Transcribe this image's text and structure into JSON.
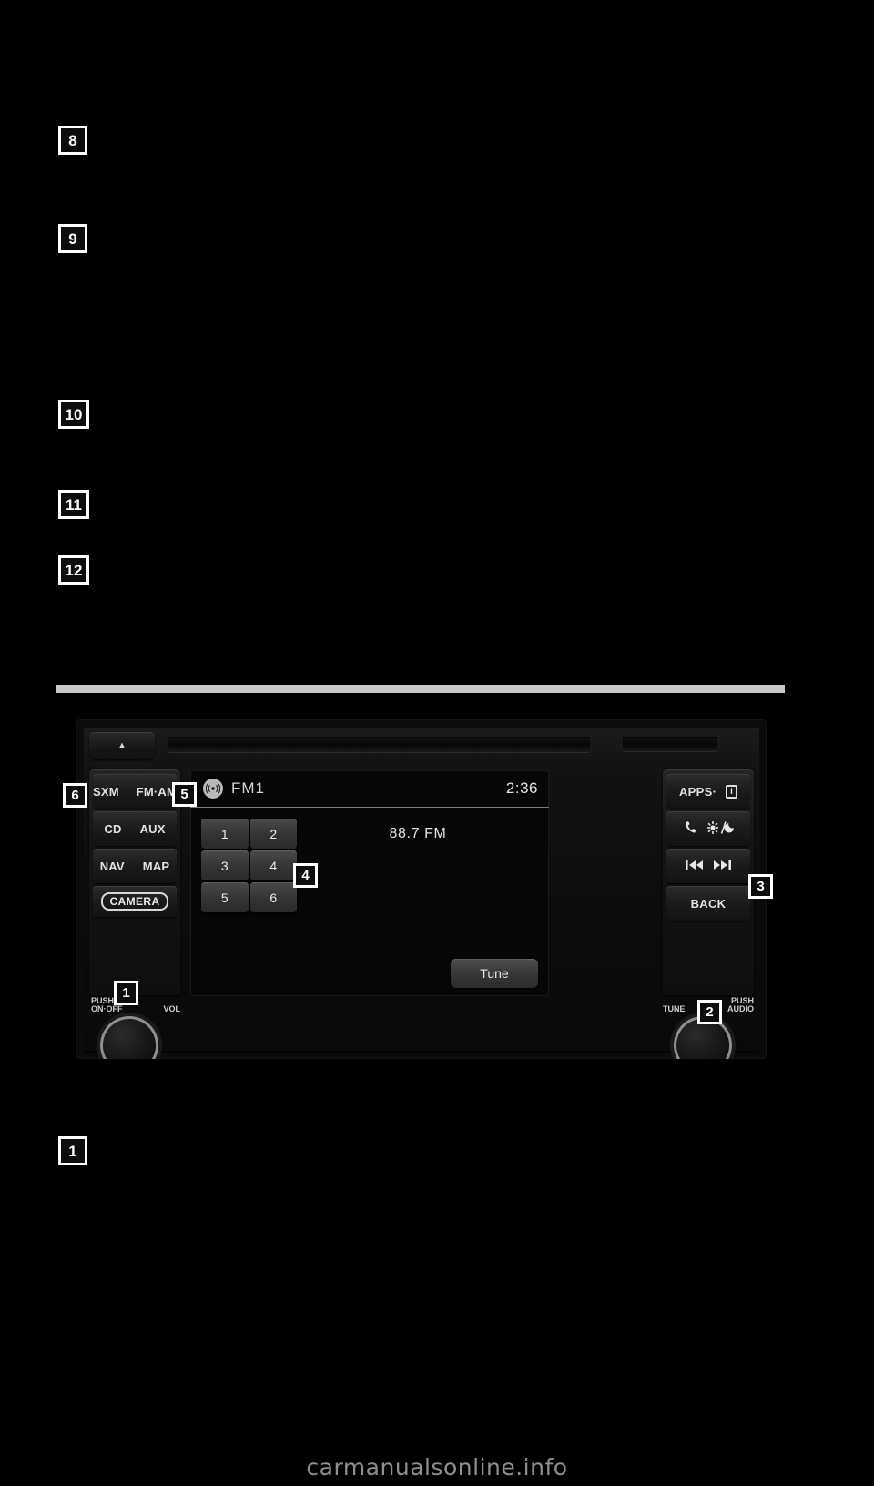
{
  "page": {
    "background_color": "#000000",
    "watermark": "carmanualsonline.info",
    "divider_color": "#c6c8ca"
  },
  "text_callouts": [
    {
      "number": "8"
    },
    {
      "number": "9"
    },
    {
      "number": "10"
    },
    {
      "number": "11"
    },
    {
      "number": "12"
    },
    {
      "number": "1"
    }
  ],
  "figure": {
    "name": "audio-head-unit",
    "callouts": [
      {
        "number": "1"
      },
      {
        "number": "2"
      },
      {
        "number": "3"
      },
      {
        "number": "4"
      },
      {
        "number": "5"
      },
      {
        "number": "6"
      }
    ],
    "top_strip": {
      "eject_icon": "eject-icon",
      "eject_glyph": "▲",
      "cd_slot": "cd-slot",
      "aux_slot": "aux-slot"
    },
    "left_buttons": [
      {
        "left_label": "SXM",
        "right_label": "FM·AM"
      },
      {
        "left_label": "CD",
        "right_label": "AUX"
      },
      {
        "left_label": "NAV",
        "right_label": "MAP"
      }
    ],
    "camera_button": "CAMERA",
    "volume_knob": {
      "label_left_line1": "PUSH",
      "label_left_line2": "ON·OFF",
      "label_right": "VOL"
    },
    "tune_knob": {
      "label_left": "TUNE",
      "label_right_line1": "PUSH",
      "label_right_line2": "AUDIO"
    },
    "right_buttons": [
      {
        "label": "APPS·",
        "icon": "info-icon",
        "icon_glyph": "i"
      },
      {
        "label": "",
        "icon_left": "phone-icon",
        "icon_left_glyph": "✆",
        "icon_right": "brightness-day-night-icon",
        "icon_right_glyph": "☀/☽"
      },
      {
        "label": "",
        "icon_left": "skip-previous-icon",
        "icon_left_glyph": "⏮",
        "icon_right": "skip-next-icon",
        "icon_right_glyph": "⏭"
      },
      {
        "label": "BACK",
        "icon": null
      }
    ],
    "screen": {
      "source_icon": "radio-waves-icon",
      "source_icon_glyph": "((•))",
      "mode": "FM1",
      "clock": "2:36",
      "presets": [
        "1",
        "2",
        "3",
        "4",
        "5",
        "6"
      ],
      "frequency": "88.7 FM",
      "tune_button": "Tune"
    }
  }
}
